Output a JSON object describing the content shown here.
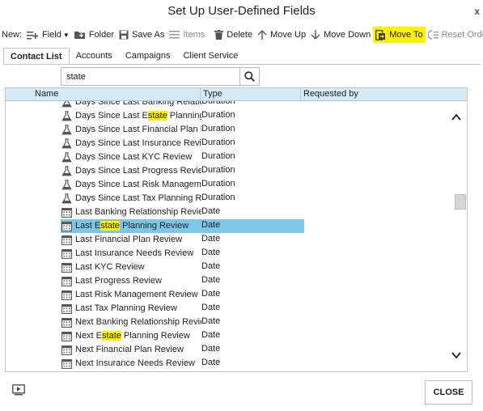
{
  "window": {
    "title": "Set Up User-Defined Fields",
    "close_glyph": "x"
  },
  "toolbar": {
    "new_label": "New:",
    "field": "Field",
    "folder": "Folder",
    "save_as": "Save As",
    "items": "Items",
    "delete": "Delete",
    "move_up": "Move Up",
    "move_down": "Move Down",
    "move_to": "Move To",
    "reset_order": "Reset Order",
    "highlight_color": "#fff200"
  },
  "tabs": [
    {
      "label": "Contact List",
      "active": true
    },
    {
      "label": "Accounts",
      "active": false
    },
    {
      "label": "Campaigns",
      "active": false
    },
    {
      "label": "Client Service",
      "active": false
    }
  ],
  "search": {
    "value": "state"
  },
  "grid": {
    "columns": [
      "Name",
      "Type",
      "Requested by"
    ],
    "header_color": "#d4eaf7",
    "selected_color": "#7fc6e6",
    "rows": [
      {
        "icon": "flask-icon",
        "name": [
          "Days Since Last Banking Relations",
          "",
          ""
        ],
        "type": "Duration",
        "partial_top": true
      },
      {
        "icon": "flask-icon",
        "name": [
          "Days Since Last E",
          "state",
          " Planning Re"
        ],
        "type": "Duration"
      },
      {
        "icon": "flask-icon",
        "name": [
          "Days Since Last Financial Plan Rev",
          "",
          ""
        ],
        "type": "Duration"
      },
      {
        "icon": "flask-icon",
        "name": [
          "Days Since Last Insurance Review",
          "",
          ""
        ],
        "type": "Duration"
      },
      {
        "icon": "flask-icon",
        "name": [
          "Days Since Last KYC Review",
          "",
          ""
        ],
        "type": "Duration"
      },
      {
        "icon": "flask-icon",
        "name": [
          "Days Since Last Progress Review",
          "",
          ""
        ],
        "type": "Duration"
      },
      {
        "icon": "flask-icon",
        "name": [
          "Days Since Last Risk Management",
          "",
          ""
        ],
        "type": "Duration"
      },
      {
        "icon": "flask-icon",
        "name": [
          "Days Since Last Tax Planning Revie",
          "",
          ""
        ],
        "type": "Duration"
      },
      {
        "icon": "calendar-icon",
        "name": [
          "Last Banking Relationship Review",
          "",
          ""
        ],
        "type": "Date"
      },
      {
        "icon": "calendar-icon",
        "name": [
          "Last E",
          "state",
          " Planning Review"
        ],
        "type": "Date",
        "selected": true
      },
      {
        "icon": "calendar-icon",
        "name": [
          "Last Financial Plan Review",
          "",
          ""
        ],
        "type": "Date"
      },
      {
        "icon": "calendar-icon",
        "name": [
          "Last Insurance Needs Review",
          "",
          ""
        ],
        "type": "Date"
      },
      {
        "icon": "calendar-icon",
        "name": [
          "Last KYC Review",
          "",
          ""
        ],
        "type": "Date"
      },
      {
        "icon": "calendar-icon",
        "name": [
          "Last Progress Review",
          "",
          ""
        ],
        "type": "Date"
      },
      {
        "icon": "calendar-icon",
        "name": [
          "Last Risk Management Review",
          "",
          ""
        ],
        "type": "Date"
      },
      {
        "icon": "calendar-icon",
        "name": [
          "Last Tax Planning Review",
          "",
          ""
        ],
        "type": "Date"
      },
      {
        "icon": "calendar-icon",
        "name": [
          "Next Banking Relationship Review",
          "",
          ""
        ],
        "type": "Date"
      },
      {
        "icon": "calendar-icon",
        "name": [
          "Next E",
          "state",
          " Planning Review"
        ],
        "type": "Date"
      },
      {
        "icon": "calendar-icon",
        "name": [
          "Next Financial Plan Review",
          "",
          ""
        ],
        "type": "Date"
      },
      {
        "icon": "calendar-icon",
        "name": [
          "Next Insurance Needs Review",
          "",
          ""
        ],
        "type": "Date"
      }
    ]
  },
  "footer": {
    "close_label": "CLOSE"
  }
}
